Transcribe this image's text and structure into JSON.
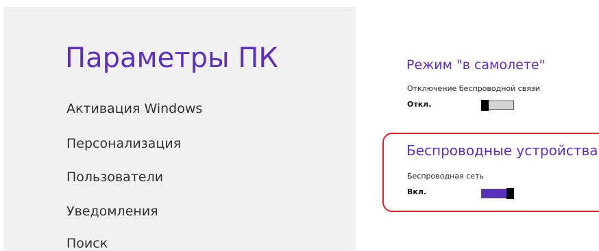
{
  "app": {
    "title": "Параметры ПК"
  },
  "nav": {
    "items": [
      {
        "label": "Активация Windows"
      },
      {
        "label": "Персонализация"
      },
      {
        "label": "Пользователи"
      },
      {
        "label": "Уведомления"
      },
      {
        "label": "Поиск"
      }
    ]
  },
  "airplane": {
    "title": "Режим \"в самолете\"",
    "setting_label": "Отключение беспроводной связи",
    "state": "Откл.",
    "on": false
  },
  "wireless": {
    "title": "Беспроводные устройства",
    "setting_label": "Беспроводная сеть",
    "state": "Вкл.",
    "on": true
  },
  "colors": {
    "accent": "#5b2fbf",
    "highlight_border": "#e8212a",
    "left_pane_bg": "#f1f1f1"
  }
}
